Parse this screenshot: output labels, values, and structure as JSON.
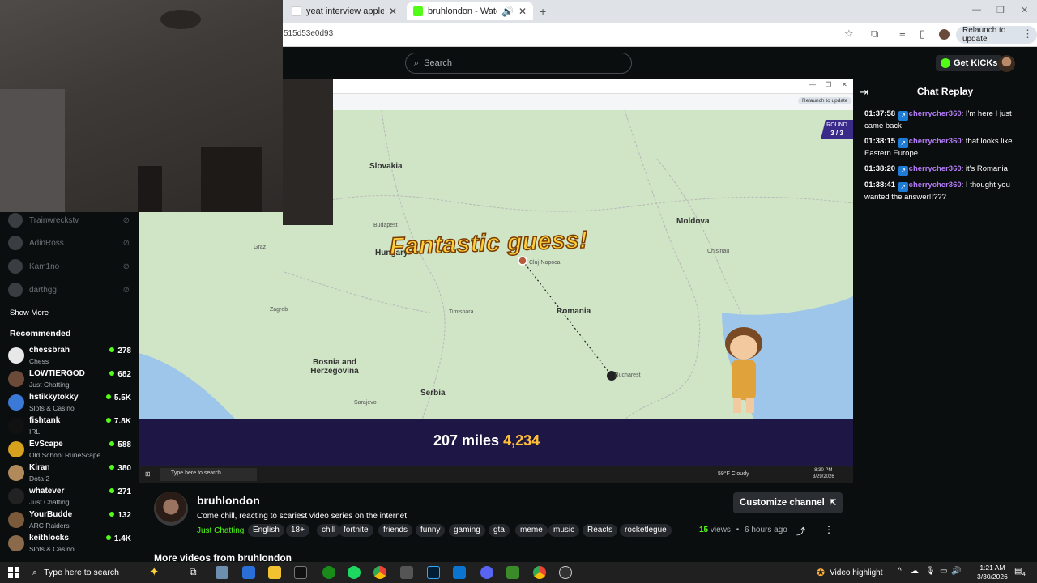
{
  "browser": {
    "tabs": [
      {
        "title": "yeat interview apple - Google S"
      },
      {
        "title": "bruhlondon - Watch the VO"
      }
    ],
    "url": "515d53e0d93",
    "relaunch_label": "Relaunch to update"
  },
  "header": {
    "search_placeholder": "Search",
    "get_kicks_label": "Get KICKs"
  },
  "sidebar": {
    "following": [
      "Trainwreckstv",
      "AdinRoss",
      "Kam1no",
      "darthgg"
    ],
    "show_more": "Show More",
    "recommended_title": "Recommended",
    "recommended": [
      {
        "name": "chessbrah",
        "category": "Chess",
        "viewers": "278",
        "color": "#e8e8e8"
      },
      {
        "name": "LOWTIERGOD",
        "category": "Just Chatting",
        "viewers": "682",
        "color": "#6b4a3a"
      },
      {
        "name": "hstikkytokky",
        "category": "Slots & Casino",
        "viewers": "5.5K",
        "color": "#3a7ad6"
      },
      {
        "name": "fishtank",
        "category": "IRL",
        "viewers": "7.8K",
        "color": "#111111"
      },
      {
        "name": "EvScape",
        "category": "Old School RuneScape",
        "viewers": "588",
        "color": "#d6a21e"
      },
      {
        "name": "Kiran",
        "category": "Dota 2",
        "viewers": "380",
        "color": "#b08a5a"
      },
      {
        "name": "whatever",
        "category": "Just Chatting",
        "viewers": "271",
        "color": "#222222"
      },
      {
        "name": "YourBudde",
        "category": "ARC Raiders",
        "viewers": "132",
        "color": "#7a5a3a"
      },
      {
        "name": "keithlocks",
        "category": "Slots & Casino",
        "viewers": "1.4K",
        "color": "#8a6a4a"
      }
    ]
  },
  "video": {
    "inner_relaunch": "Relaunch to update",
    "round_label": "ROUND",
    "round_value": "3 / 3",
    "map_labels": [
      "Slovakia",
      "Moldova",
      "Hungary",
      "Romania",
      "Bosnia and Herzegovina",
      "Serbia"
    ],
    "small_labels": [
      "Budapest",
      "Graz",
      "Zagreb",
      "Cluj-Napoca",
      "Timisoara",
      "Bucharest",
      "Sarajevo",
      "Chisinau"
    ],
    "banner": "Fantastic guess!",
    "distance": "207 miles",
    "points": "4,234",
    "inner_search": "Type here to search",
    "inner_weather": "59°F Cloudy",
    "inner_time": "8:30 PM",
    "inner_date": "3/29/2026"
  },
  "chat": {
    "title": "Chat Replay",
    "messages": [
      {
        "time": "01:37:58",
        "user": "cherrycher360",
        "text": ": I'm here I just came back"
      },
      {
        "time": "01:38:15",
        "user": "cherrycher360",
        "text": ": that looks like Eastern Europe"
      },
      {
        "time": "01:38:20",
        "user": "cherrycher360",
        "text": ": it's Romania"
      },
      {
        "time": "01:38:41",
        "user": "cherrycher360",
        "text": ": I thought you wanted the answer!!???"
      }
    ]
  },
  "channel": {
    "name": "bruhlondon",
    "description": "Come chill, reacting to scariest video series on the internet",
    "category": "Just Chatting",
    "tags": [
      "English",
      "18+",
      "chill",
      "fortnite",
      "friends",
      "funny",
      "gaming",
      "gta",
      "meme",
      "music",
      "Reacts",
      "rocketlegue"
    ],
    "customize_label": "Customize channel",
    "views_count": "15",
    "views_label": "views",
    "age": "6 hours ago",
    "more_videos": "More videos from bruhlondon"
  },
  "taskbar": {
    "search_placeholder": "Type here to search",
    "video_highlight": "Video highlight",
    "time": "1:21 AM",
    "date": "3/30/2026",
    "notifications": "4"
  },
  "colors": {
    "kick_green": "#53fc18",
    "chat_username": "#b37cf6",
    "background": "#0b0e0f"
  }
}
